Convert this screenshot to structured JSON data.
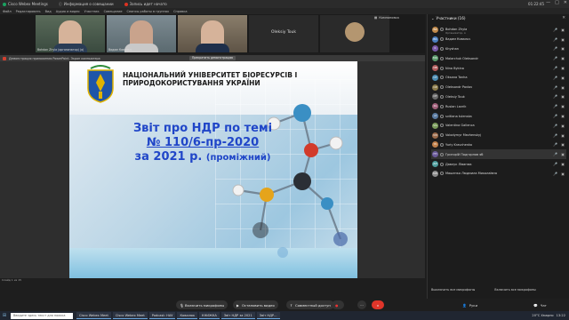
{
  "titlebar": {
    "app_name": "Cisco Webex Meetings",
    "info_label": "Информация о совещании",
    "recording_label": "Запись идет начато",
    "time": "01:22:45"
  },
  "menubar": {
    "items": [
      "Файл",
      "Редактировать",
      "Вид",
      "Аудио и видео",
      "Участник",
      "Совещание",
      "Сеансы работы в группах",
      "Справка"
    ]
  },
  "videos": {
    "tiles": [
      {
        "name": "Bohdan Zhyla (организатор) (я)"
      },
      {
        "name": "Вадим Ковальч"
      },
      {
        "name": ""
      },
      {
        "name": "Oleksiy Touk"
      },
      {
        "name": ""
      }
    ],
    "compact_label": "Компоновка"
  },
  "share_bar": {
    "message": "Демонстрация приложения PowerPoint. Экран компьютера",
    "stop_label": "Прекратить демонстрацию"
  },
  "slide": {
    "university_name": "НАЦІОНАЛЬНИЙ УНІВЕРСИТЕТ БІОРЕСУРСІВ І ПРИРОДОКОРИСТУВАННЯ УКРАЇНИ",
    "title_line1": "Звіт про НДР по темі",
    "title_line2": "№ 110/6-пр-2020",
    "title_line3": "за 2021 р.",
    "title_line3_suffix": "(проміжний)",
    "footer": "Слайд 1 из 15"
  },
  "controls": {
    "mic_label": "Включить микрофоны",
    "video_label": "Остановить видео",
    "share_label": "Совместный доступ",
    "record_label": "",
    "more_label": "···",
    "end_label": "×",
    "hands_label": "Руки",
    "chat_label": "Чат"
  },
  "panel": {
    "header": "Участники (16)",
    "participants": [
      {
        "name": "Bohdan Zhyla",
        "sub": "Организатор, я",
        "initials": "BZ"
      },
      {
        "name": "Вадим Ковальч",
        "sub": "",
        "initials": "ВК"
      },
      {
        "name": "Khyshan",
        "sub": "",
        "initials": "K"
      },
      {
        "name": "Malarchuk Oleksandr",
        "sub": "",
        "initials": "MO"
      },
      {
        "name": "Nina Bykina",
        "sub": "",
        "initials": "NB"
      },
      {
        "name": "Oksana Tonha",
        "sub": "",
        "initials": "OT"
      },
      {
        "name": "Oleksandr Pavlov",
        "sub": "",
        "initials": "OP"
      },
      {
        "name": "Oleksiy Touk",
        "sub": "",
        "initials": "OT"
      },
      {
        "name": "Ruslan Lavrik",
        "sub": "",
        "initials": "RL"
      },
      {
        "name": "svitlana tulenska",
        "sub": "",
        "initials": "st"
      },
      {
        "name": "Valentina Gallenca",
        "sub": "",
        "initials": "VG"
      },
      {
        "name": "Volodymyr Mezhenskyj",
        "sub": "",
        "initials": "VM"
      },
      {
        "name": "Yuriy Kravchenko",
        "sub": "",
        "initials": "YK"
      },
      {
        "name": "Григорій Подгорнов яб",
        "sub": "",
        "initials": "ГП"
      },
      {
        "name": "Давлук Ліванюк",
        "sub": "",
        "initials": "ДЛ"
      },
      {
        "name": "Машенко Людмила Миколаївна",
        "sub": "",
        "initials": "МЛ"
      }
    ],
    "mute_all": "Выключить все микрофоны",
    "unmute_all": "Включить все микрофоны"
  },
  "taskbar": {
    "search_placeholder": "Введите здесь текст для поиска",
    "items": [
      "Cisco Webex Meet",
      "Cisco Webex Meet",
      "Podcast: НАУ",
      "Ковалюк",
      "КНИЖКА",
      "Звіт НДР за 2021",
      "Звіт НДР..."
    ],
    "temp": "20°C  Хмарно",
    "clock": "13:22"
  }
}
